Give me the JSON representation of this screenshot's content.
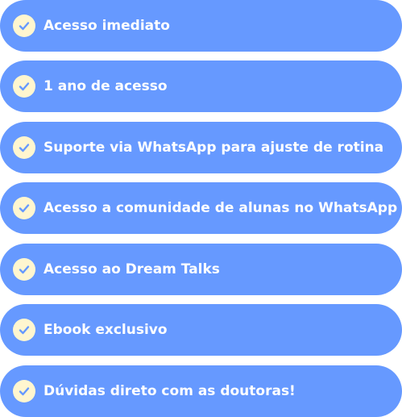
{
  "colors": {
    "pill_background": "#6699FF",
    "check_badge_background": "#FFF6CF",
    "check_mark": "#6699FF",
    "label_text": "#FFFFFF"
  },
  "benefits": [
    {
      "label": "Acesso imediato",
      "icon": "check-icon"
    },
    {
      "label": "1 ano de acesso",
      "icon": "check-icon"
    },
    {
      "label": "Suporte via WhatsApp para ajuste de rotina",
      "icon": "check-icon"
    },
    {
      "label": "Acesso a comunidade de alunas no WhatsApp",
      "icon": "check-icon"
    },
    {
      "label": "Acesso ao Dream Talks",
      "icon": "check-icon"
    },
    {
      "label": "Ebook exclusivo",
      "icon": "check-icon"
    },
    {
      "label": "Dúvidas direto com as doutoras!",
      "icon": "check-icon"
    }
  ]
}
